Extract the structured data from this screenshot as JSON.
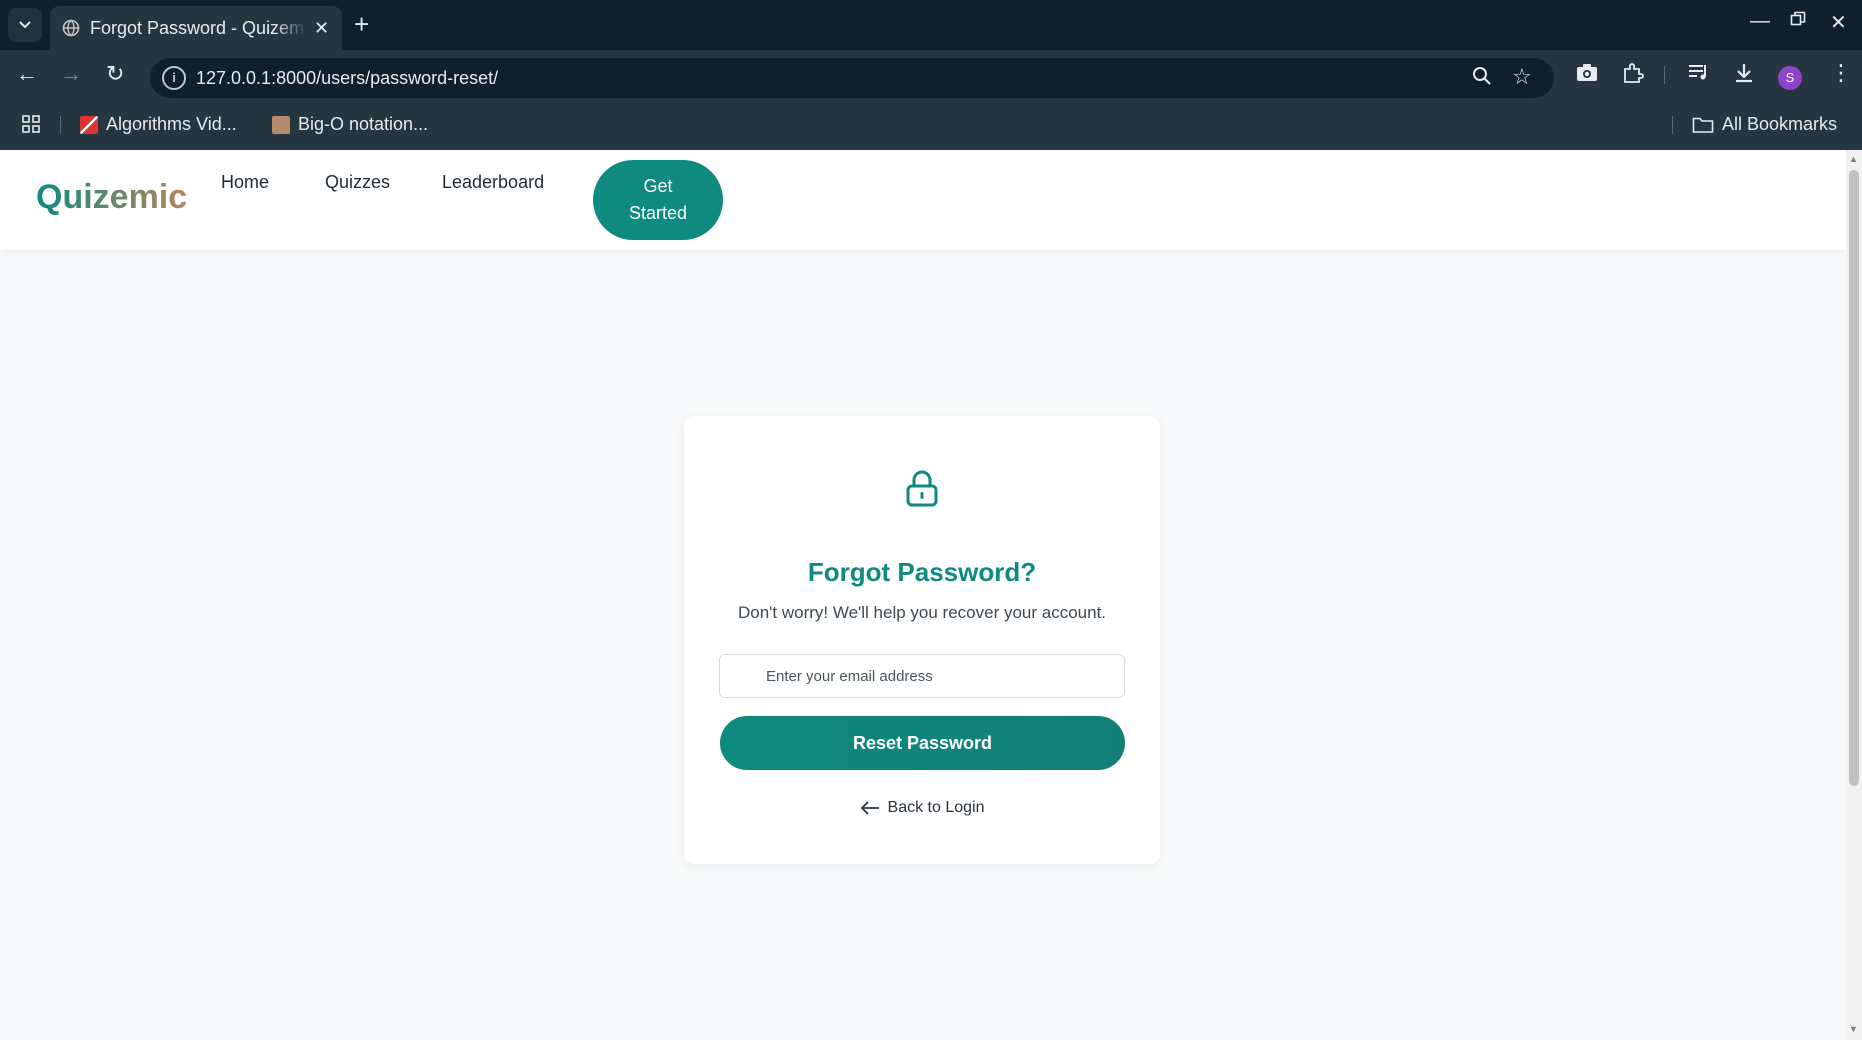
{
  "browser": {
    "tab_title": "Forgot Password - Quizemic",
    "url": "127.0.0.1:8000/users/password-reset/",
    "profile_initial": "S",
    "bookmarks": [
      {
        "label": "Algorithms Vid..."
      },
      {
        "label": "Big-O notation..."
      }
    ],
    "all_bookmarks_label": "All Bookmarks"
  },
  "navbar": {
    "logo": "Quizemic",
    "links": [
      {
        "label": "Home"
      },
      {
        "label": "Quizzes"
      },
      {
        "label": "Leaderboard"
      }
    ],
    "cta_line1": "Get",
    "cta_line2": "Started"
  },
  "reset_card": {
    "title": "Forgot Password?",
    "subtitle": "Don't worry! We'll help you recover your account.",
    "email_placeholder": "Enter your email address",
    "email_value": "",
    "submit_label": "Reset Password",
    "back_label": "Back to Login"
  },
  "colors": {
    "brand": "#0f8a7e",
    "chrome_dark": "#0f1f2b",
    "chrome_toolbar": "#263640"
  }
}
